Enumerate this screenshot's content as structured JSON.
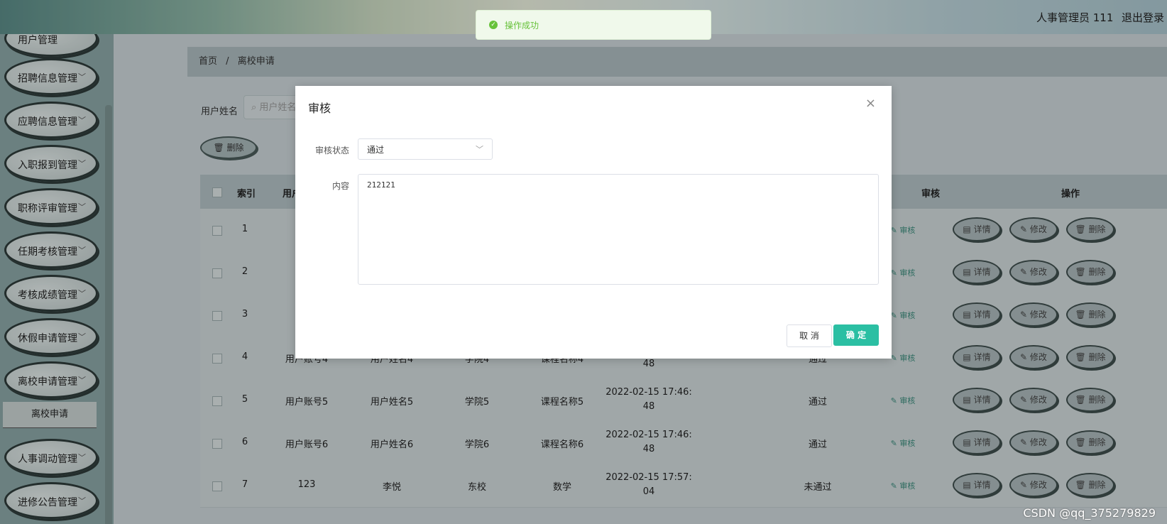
{
  "header": {
    "user_label": "人事管理员 111",
    "logout": "退出登录"
  },
  "sidebar": {
    "items": [
      {
        "label": "用户管理"
      },
      {
        "label": "招聘信息管理"
      },
      {
        "label": "应聘信息管理"
      },
      {
        "label": "入职报到管理"
      },
      {
        "label": "职称评审管理"
      },
      {
        "label": "任期考核管理"
      },
      {
        "label": "考核成绩管理"
      },
      {
        "label": "休假申请管理"
      },
      {
        "label": "离校申请管理"
      },
      {
        "label": "人事调动管理"
      },
      {
        "label": "进修公告管理"
      }
    ],
    "active_sub": "离校申请"
  },
  "breadcrumb": {
    "home": "首页",
    "sep": "/",
    "current": "离校申请"
  },
  "search": {
    "label": "用户姓名",
    "placeholder": "用户姓名"
  },
  "toolbar": {
    "delete_label": "删除"
  },
  "table": {
    "headers": {
      "index": "索引",
      "user_account": "用户",
      "audit": "审核",
      "ops": "操作"
    },
    "rows": [
      {
        "idx": "1",
        "account": "用",
        "name": "",
        "college": "",
        "course": "",
        "time1": "",
        "time2": "",
        "status": "",
        "audit": "审核"
      },
      {
        "idx": "2",
        "account": "用",
        "name": "",
        "college": "",
        "course": "",
        "time1": "",
        "time2": "",
        "status": "",
        "audit": "审核"
      },
      {
        "idx": "3",
        "account": "用",
        "name": "",
        "college": "",
        "course": "",
        "time1": "",
        "time2": "",
        "status": "",
        "audit": "审核"
      },
      {
        "idx": "4",
        "account": "用户账号4",
        "name": "用户姓名4",
        "college": "学院4",
        "course": "课程名称4",
        "time1": "",
        "time2": "48",
        "status": "通过",
        "audit": "审核"
      },
      {
        "idx": "5",
        "account": "用户账号5",
        "name": "用户姓名5",
        "college": "学院5",
        "course": "课程名称5",
        "time1": "2022-02-15 17:46:",
        "time2": "48",
        "status": "通过",
        "audit": "审核"
      },
      {
        "idx": "6",
        "account": "用户账号6",
        "name": "用户姓名6",
        "college": "学院6",
        "course": "课程名称6",
        "time1": "2022-02-15 17:46:",
        "time2": "48",
        "status": "通过",
        "audit": "审核"
      },
      {
        "idx": "7",
        "account": "123",
        "name": "李悦",
        "college": "东校",
        "course": "数学",
        "time1": "2022-02-15 17:57:",
        "time2": "04",
        "status": "未通过",
        "audit": "审核"
      }
    ],
    "op_labels": {
      "detail": "详情",
      "edit": "修改",
      "delete": "删除"
    }
  },
  "dialog": {
    "title": "审核",
    "status_label": "审核状态",
    "status_value": "通过",
    "content_label": "内容",
    "content_value": "212121",
    "cancel": "取 消",
    "confirm": "确 定"
  },
  "toast": {
    "message": "操作成功"
  },
  "watermark": "CSDN @qq_375279829"
}
